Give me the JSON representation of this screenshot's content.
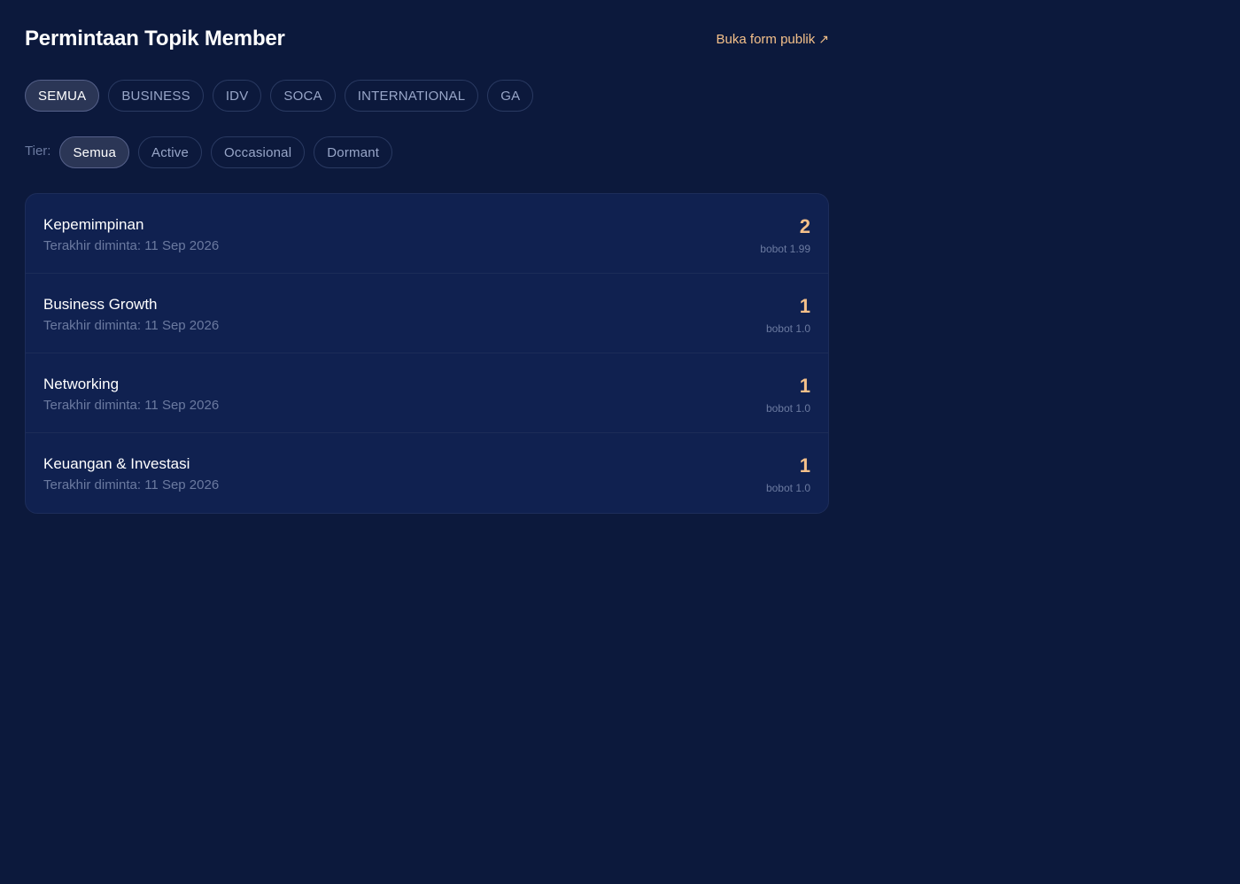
{
  "header": {
    "title": "Permintaan Topik Member",
    "public_link_label": "Buka form publik",
    "public_link_icon": "external-arrow-icon",
    "public_link_glyph": "↗"
  },
  "categories": {
    "items": [
      {
        "label": "SEMUA",
        "active": true
      },
      {
        "label": "BUSINESS",
        "active": false
      },
      {
        "label": "IDV",
        "active": false
      },
      {
        "label": "SOCA",
        "active": false
      },
      {
        "label": "INTERNATIONAL",
        "active": false
      },
      {
        "label": "GA",
        "active": false
      }
    ]
  },
  "tiers": {
    "label": "Tier:",
    "items": [
      {
        "label": "Semua",
        "active": true
      },
      {
        "label": "Active",
        "active": false
      },
      {
        "label": "Occasional",
        "active": false
      },
      {
        "label": "Dormant",
        "active": false
      }
    ]
  },
  "topics": [
    {
      "name": "Kepemimpinan",
      "last_requested": "Terakhir diminta: 11 Sep 2026",
      "count": "2",
      "weight": "bobot 1.99"
    },
    {
      "name": "Business Growth",
      "last_requested": "Terakhir diminta: 11 Sep 2026",
      "count": "1",
      "weight": "bobot 1.0"
    },
    {
      "name": "Networking",
      "last_requested": "Terakhir diminta: 11 Sep 2026",
      "count": "1",
      "weight": "bobot 1.0"
    },
    {
      "name": "Keuangan & Investasi",
      "last_requested": "Terakhir diminta: 11 Sep 2026",
      "count": "1",
      "weight": "bobot 1.0"
    }
  ],
  "colors": {
    "background": "#0c193c",
    "card": "#102150",
    "accent": "#f4c08a",
    "muted": "#6b7aa0"
  }
}
